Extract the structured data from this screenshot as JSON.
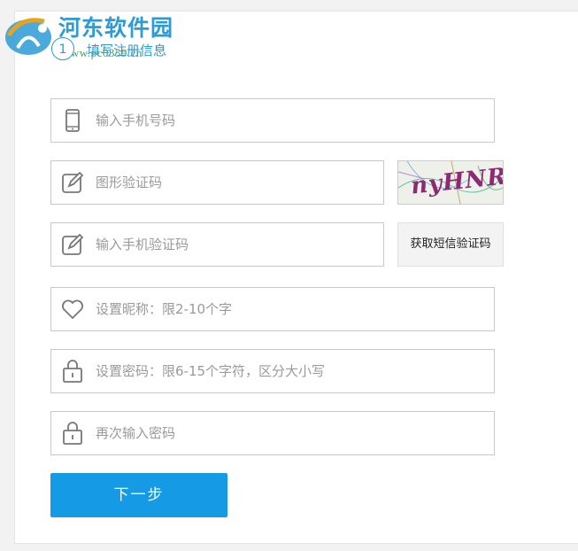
{
  "watermark": {
    "title": "河东软件园",
    "url": "www.pc0359.cn"
  },
  "step": {
    "number": "1",
    "label": "填写注册信息"
  },
  "form": {
    "phone_placeholder": "输入手机号码",
    "captcha_placeholder": "图形验证码",
    "captcha_text": "nyHNR",
    "sms_code_placeholder": "输入手机验证码",
    "sms_button_label": "获取短信验证码",
    "nickname_placeholder": "设置昵称：限2-10个字",
    "password_placeholder": "设置密码：限6-15个字符，区分大小写",
    "confirm_password_placeholder": "再次输入密码",
    "next_button_label": "下一步"
  },
  "colors": {
    "accent": "#159ae6",
    "border": "#c9c9c9",
    "placeholder": "#9a9a9a"
  },
  "icons": {
    "phone": "phone-icon",
    "captcha": "edit-icon",
    "sms": "edit-icon",
    "nickname": "heart-icon",
    "password": "lock-icon",
    "confirm": "lock-icon"
  }
}
